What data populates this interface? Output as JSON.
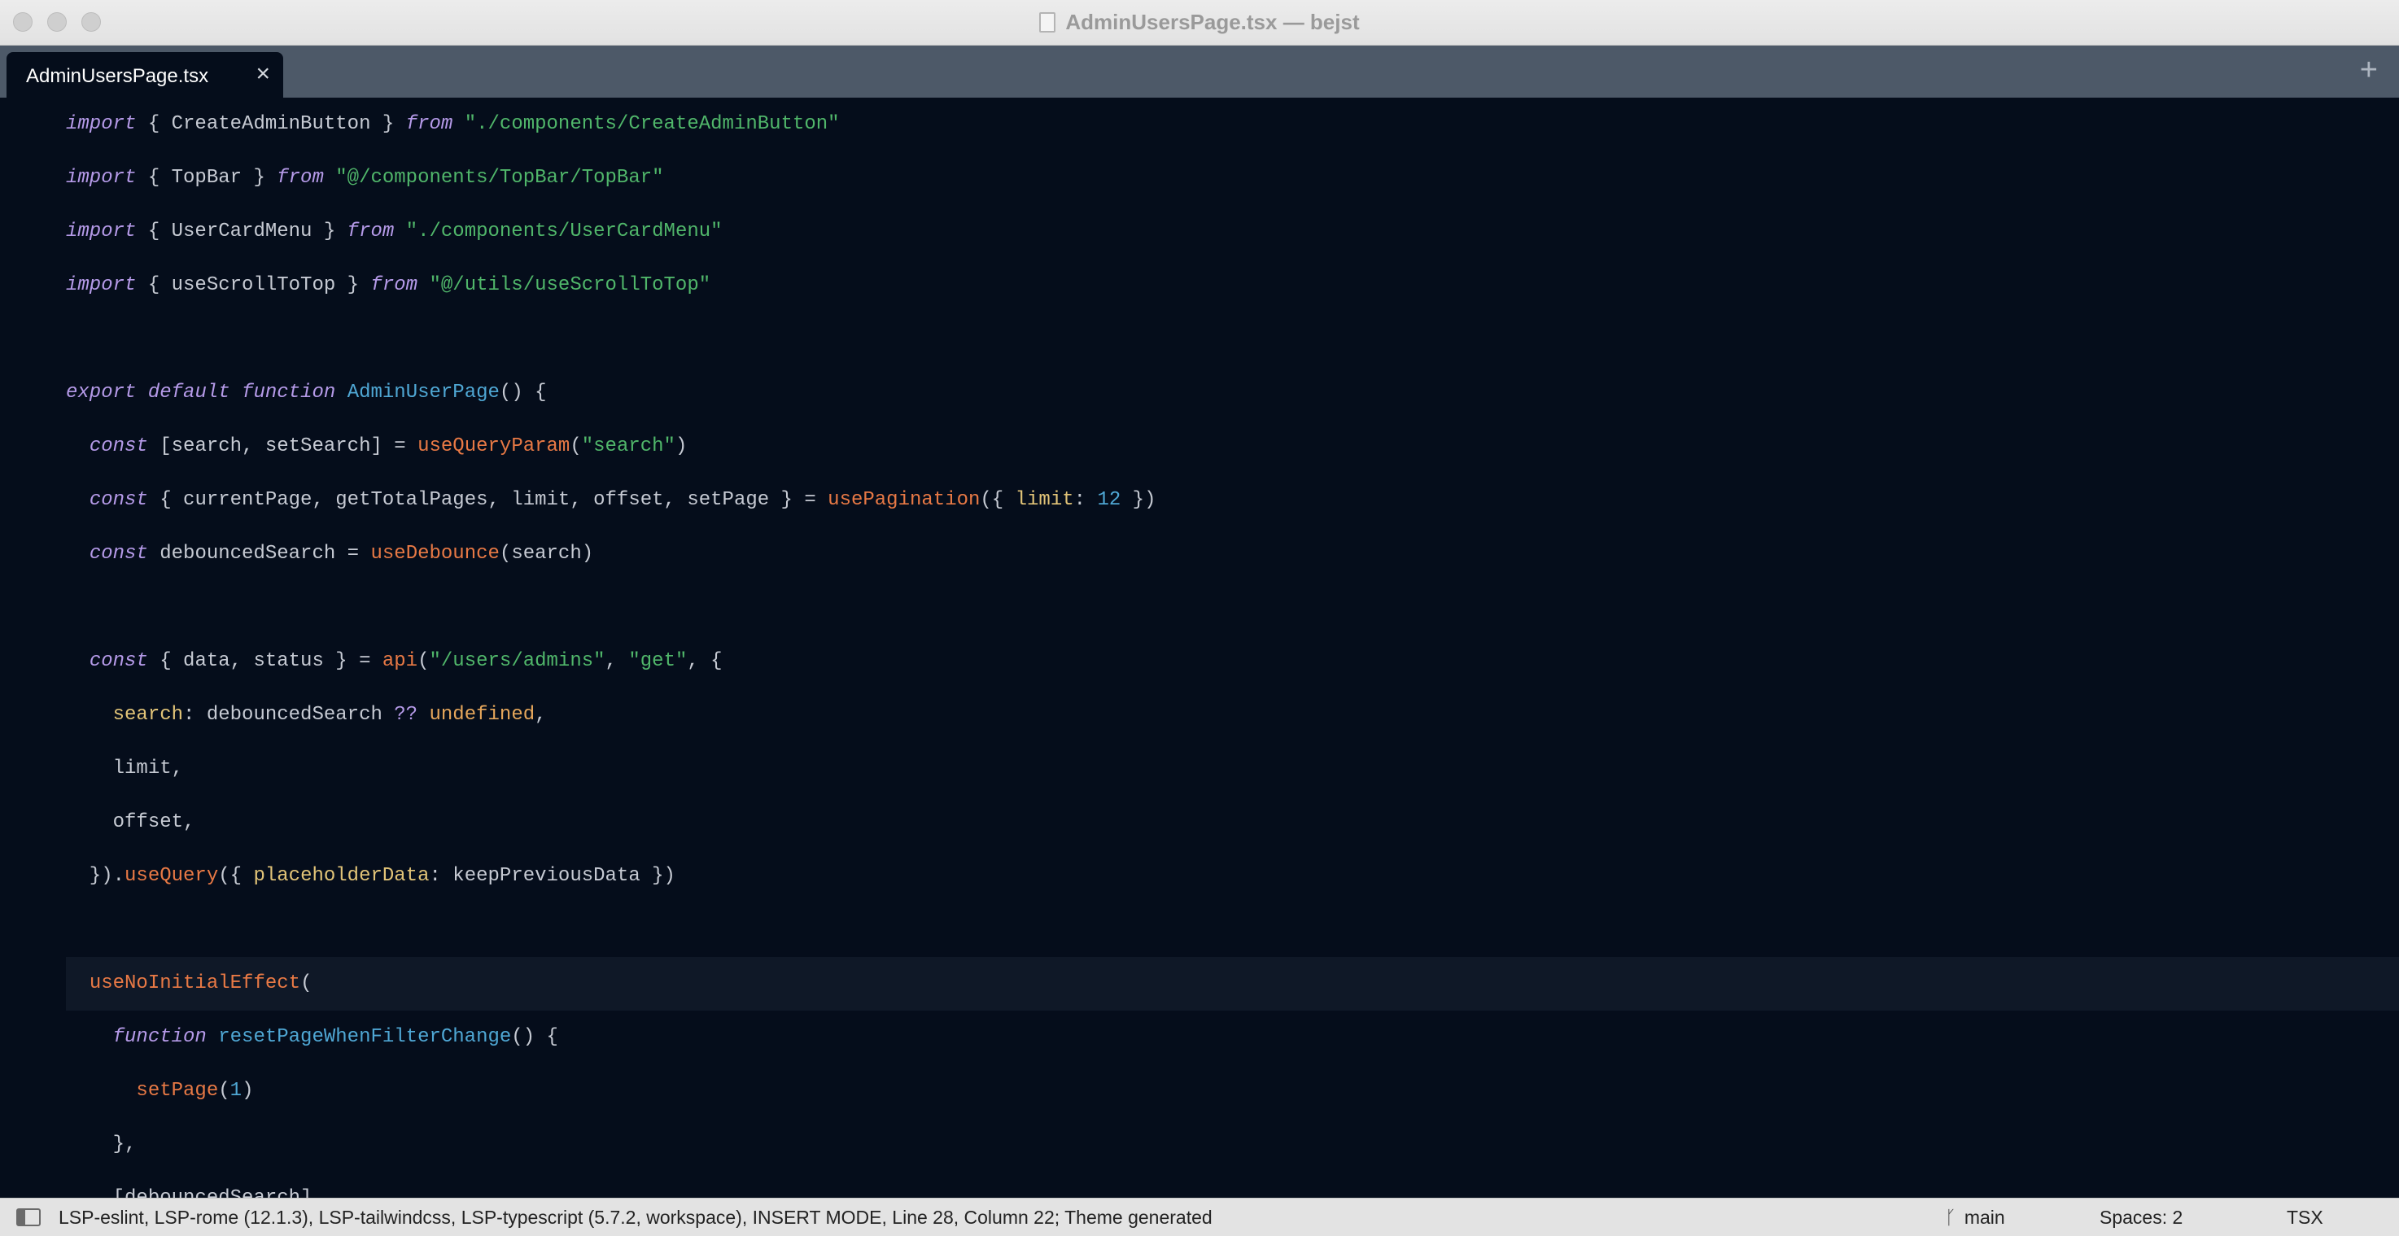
{
  "window": {
    "title": "AdminUsersPage.tsx — bejst"
  },
  "tabs": [
    {
      "label": "AdminUsersPage.tsx",
      "close": "×"
    }
  ],
  "new_tab": "+",
  "code_lines": [
    [
      [
        "kw",
        "import"
      ],
      [
        "pl",
        " { CreateAdminButton } "
      ],
      [
        "kw",
        "from"
      ],
      [
        "pl",
        " "
      ],
      [
        "str",
        "\"./components/CreateAdminButton\""
      ]
    ],
    [
      [
        "kw",
        "import"
      ],
      [
        "pl",
        " { TopBar } "
      ],
      [
        "kw",
        "from"
      ],
      [
        "pl",
        " "
      ],
      [
        "str",
        "\"@/components/TopBar/TopBar\""
      ]
    ],
    [
      [
        "kw",
        "import"
      ],
      [
        "pl",
        " { UserCardMenu } "
      ],
      [
        "kw",
        "from"
      ],
      [
        "pl",
        " "
      ],
      [
        "str",
        "\"./components/UserCardMenu\""
      ]
    ],
    [
      [
        "kw",
        "import"
      ],
      [
        "pl",
        " { useScrollToTop } "
      ],
      [
        "kw",
        "from"
      ],
      [
        "pl",
        " "
      ],
      [
        "str",
        "\"@/utils/useScrollToTop\""
      ]
    ],
    [],
    [
      [
        "kw",
        "export"
      ],
      [
        "pl",
        " "
      ],
      [
        "kw",
        "default"
      ],
      [
        "pl",
        " "
      ],
      [
        "kw",
        "function"
      ],
      [
        "pl",
        " "
      ],
      [
        "ty",
        "AdminUserPage"
      ],
      [
        "pl",
        "() {"
      ]
    ],
    [
      [
        "pl",
        "  "
      ],
      [
        "kw",
        "const"
      ],
      [
        "pl",
        " [search, setSearch] = "
      ],
      [
        "fn",
        "useQueryParam"
      ],
      [
        "pl",
        "("
      ],
      [
        "str",
        "\"search\""
      ],
      [
        "pl",
        ")"
      ]
    ],
    [
      [
        "pl",
        "  "
      ],
      [
        "kw",
        "const"
      ],
      [
        "pl",
        " { currentPage, getTotalPages, limit, offset, setPage } = "
      ],
      [
        "fn",
        "usePagination"
      ],
      [
        "pl",
        "({ "
      ],
      [
        "prop",
        "limit"
      ],
      [
        "pl",
        ": "
      ],
      [
        "num",
        "12"
      ],
      [
        "pl",
        " })"
      ]
    ],
    [
      [
        "pl",
        "  "
      ],
      [
        "kw",
        "const"
      ],
      [
        "pl",
        " debouncedSearch = "
      ],
      [
        "fn",
        "useDebounce"
      ],
      [
        "pl",
        "(search)"
      ]
    ],
    [],
    [
      [
        "pl",
        "  "
      ],
      [
        "kw",
        "const"
      ],
      [
        "pl",
        " { data, status } = "
      ],
      [
        "fn",
        "api"
      ],
      [
        "pl",
        "("
      ],
      [
        "str",
        "\"/users/admins\""
      ],
      [
        "pl",
        ", "
      ],
      [
        "str",
        "\"get\""
      ],
      [
        "pl",
        ", {"
      ]
    ],
    [
      [
        "pl",
        "    "
      ],
      [
        "prop",
        "search"
      ],
      [
        "pl",
        ": debouncedSearch "
      ],
      [
        "op",
        "??"
      ],
      [
        "pl",
        " "
      ],
      [
        "lit",
        "undefined"
      ],
      [
        "pl",
        ","
      ]
    ],
    [
      [
        "pl",
        "    limit,"
      ]
    ],
    [
      [
        "pl",
        "    offset,"
      ]
    ],
    [
      [
        "pl",
        "  })."
      ],
      [
        "fn",
        "useQuery"
      ],
      [
        "pl",
        "({ "
      ],
      [
        "prop",
        "placeholderData"
      ],
      [
        "pl",
        ": keepPreviousData })"
      ]
    ],
    [],
    [
      [
        "pl",
        "  "
      ],
      [
        "fn",
        "useNoInitialEffect"
      ],
      [
        "pl",
        "("
      ]
    ],
    [
      [
        "pl",
        "    "
      ],
      [
        "kw",
        "function"
      ],
      [
        "pl",
        " "
      ],
      [
        "ty",
        "resetPageWhenFilterChange"
      ],
      [
        "pl",
        "() {"
      ]
    ],
    [
      [
        "pl",
        "      "
      ],
      [
        "fn",
        "setPage"
      ],
      [
        "pl",
        "("
      ],
      [
        "num",
        "1"
      ],
      [
        "pl",
        ")"
      ]
    ],
    [
      [
        "pl",
        "    },"
      ]
    ],
    [
      [
        "pl",
        "    [debouncedSearch],"
      ]
    ]
  ],
  "current_line_index": 16,
  "statusbar": {
    "status_text": "LSP-eslint, LSP-rome (12.1.3), LSP-tailwindcss, LSP-typescript (5.7.2, workspace), INSERT MODE, Line 28, Column 22; Theme generated",
    "branch": "main",
    "spaces": "Spaces: 2",
    "syntax": "TSX"
  }
}
